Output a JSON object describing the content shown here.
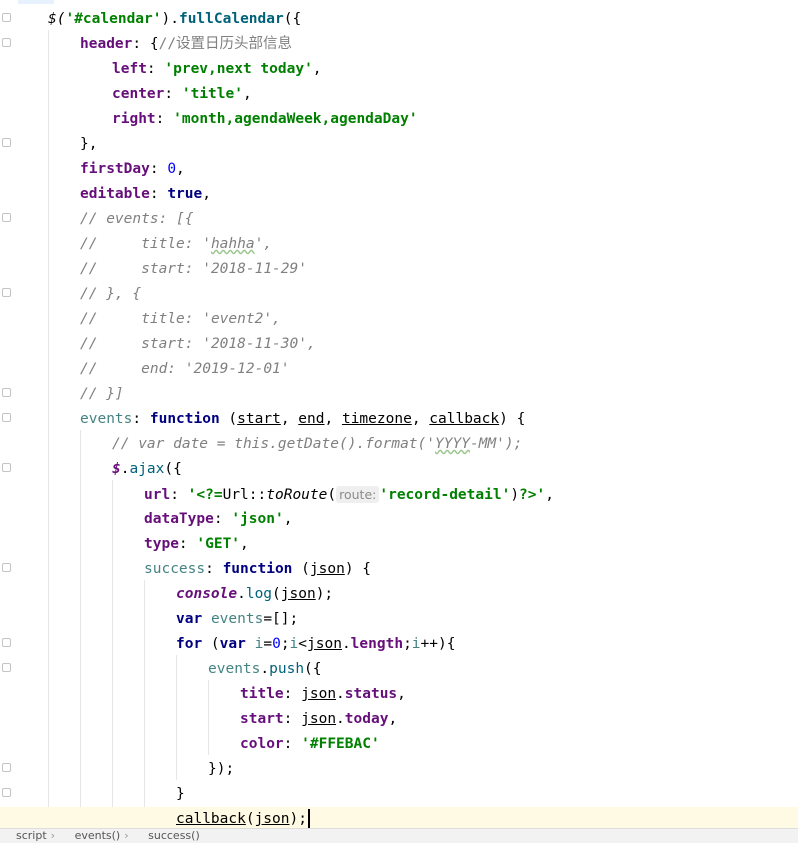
{
  "editor": {
    "lines": {
      "l1": [
        "$(",
        "'#calendar'",
        ").",
        "fullCalendar",
        "({"
      ],
      "l2": [
        "header",
        ": {",
        "//设置日历头部信息"
      ],
      "l3": [
        "left",
        ": ",
        "'prev,next today'",
        ","
      ],
      "l4": [
        "center",
        ": ",
        "'title'",
        ","
      ],
      "l5": [
        "right",
        ": ",
        "'month,agendaWeek,agendaDay'"
      ],
      "l6": [
        "},"
      ],
      "l7": [
        "firstDay",
        ": ",
        "0",
        ","
      ],
      "l8": [
        "editable",
        ": ",
        "true",
        ","
      ],
      "l9": [
        "// events: [{"
      ],
      "l10": [
        "//     title: '",
        "hahha",
        "',"
      ],
      "l11": [
        "//     start: '2018-11-29'"
      ],
      "l12": [
        "// }, {"
      ],
      "l13": [
        "//     title: 'event2',"
      ],
      "l14": [
        "//     start: '2018-11-30',"
      ],
      "l15": [
        "//     end: '2019-12-01'"
      ],
      "l16": [
        "// }]"
      ],
      "l17": [
        "events",
        ": ",
        "function",
        " (",
        "start",
        ", ",
        "end",
        ", ",
        "timezone",
        ", ",
        "callback",
        ") {"
      ],
      "l18": [
        "// var date = this.getDate().format('",
        "YYYY",
        "-MM');"
      ],
      "l19": [
        "$",
        ".",
        "ajax",
        "({"
      ],
      "l20": [
        "url",
        ": ",
        "'<?=",
        "Url",
        "::",
        "toRoute",
        "(",
        "route:",
        "'record-detail'",
        ")",
        "?>'",
        ","
      ],
      "l21": [
        "dataType",
        ": ",
        "'json'",
        ","
      ],
      "l22": [
        "type",
        ": ",
        "'GET'",
        ","
      ],
      "l23": [
        "success",
        ": ",
        "function",
        " (",
        "json",
        ") {"
      ],
      "l24": [
        "console",
        ".",
        "log",
        "(",
        "json",
        ");"
      ],
      "l25": [
        "var",
        " ",
        "events",
        "=[];"
      ],
      "l26": [
        "for",
        " (",
        "var",
        " ",
        "i",
        "=",
        "0",
        ";",
        "i",
        "<",
        "json",
        ".",
        "length",
        ";",
        "i",
        "++){"
      ],
      "l27": [
        "events",
        ".",
        "push",
        "({"
      ],
      "l28": [
        "title",
        ": ",
        "json",
        ".",
        "status",
        ","
      ],
      "l29": [
        "start",
        ": ",
        "json",
        ".",
        "today",
        ","
      ],
      "l30": [
        "color",
        ": ",
        "'#FFEBAC'"
      ],
      "l31": [
        "});"
      ],
      "l32": [
        "}"
      ],
      "l33": [
        "callback",
        "(",
        "json",
        ");"
      ]
    }
  },
  "breadcrumb": [
    "script",
    "events()",
    "success()"
  ],
  "breadcrumb_separator": "›"
}
